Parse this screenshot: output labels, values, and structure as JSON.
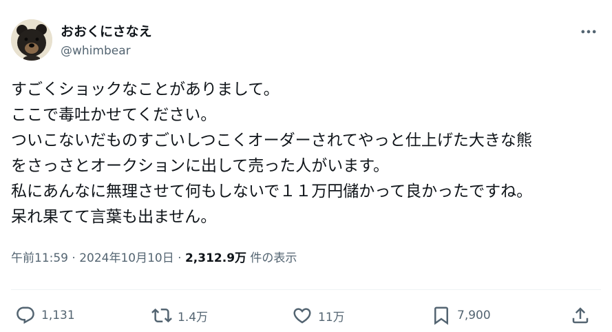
{
  "author": {
    "display_name": "おおくにさなえ",
    "handle": "@whimbear",
    "avatar": "bear-avatar"
  },
  "more_icon": "more-horizontal-icon",
  "tweet": {
    "lines": [
      "すごくショックなことがありまして。",
      "ここで毒吐かせてください。",
      "ついこないだものすごいしつこくオーダーされてやっと仕上げた大きな熊",
      "をさっさとオークションに出して売った人がいます。",
      "私にあんなに無理させて何もしないで１１万円儲かって良かったですね。",
      "呆れ果てて言葉も出ません。"
    ]
  },
  "meta": {
    "time": "午前11:59",
    "sep1": " · ",
    "date": "2024年10月10日",
    "sep2": " · ",
    "views": "2,312.9万",
    "views_label": " 件の表示"
  },
  "actions": {
    "reply": {
      "icon": "reply-icon",
      "count": "1,131"
    },
    "retweet": {
      "icon": "retweet-icon",
      "count": "1.4万"
    },
    "like": {
      "icon": "heart-icon",
      "count": "11万"
    },
    "bookmark": {
      "icon": "bookmark-icon",
      "count": "7,900"
    },
    "share": {
      "icon": "share-icon"
    }
  },
  "colors": {
    "text": "#0f1419",
    "secondary": "#536471",
    "divider": "#eff3f4"
  }
}
